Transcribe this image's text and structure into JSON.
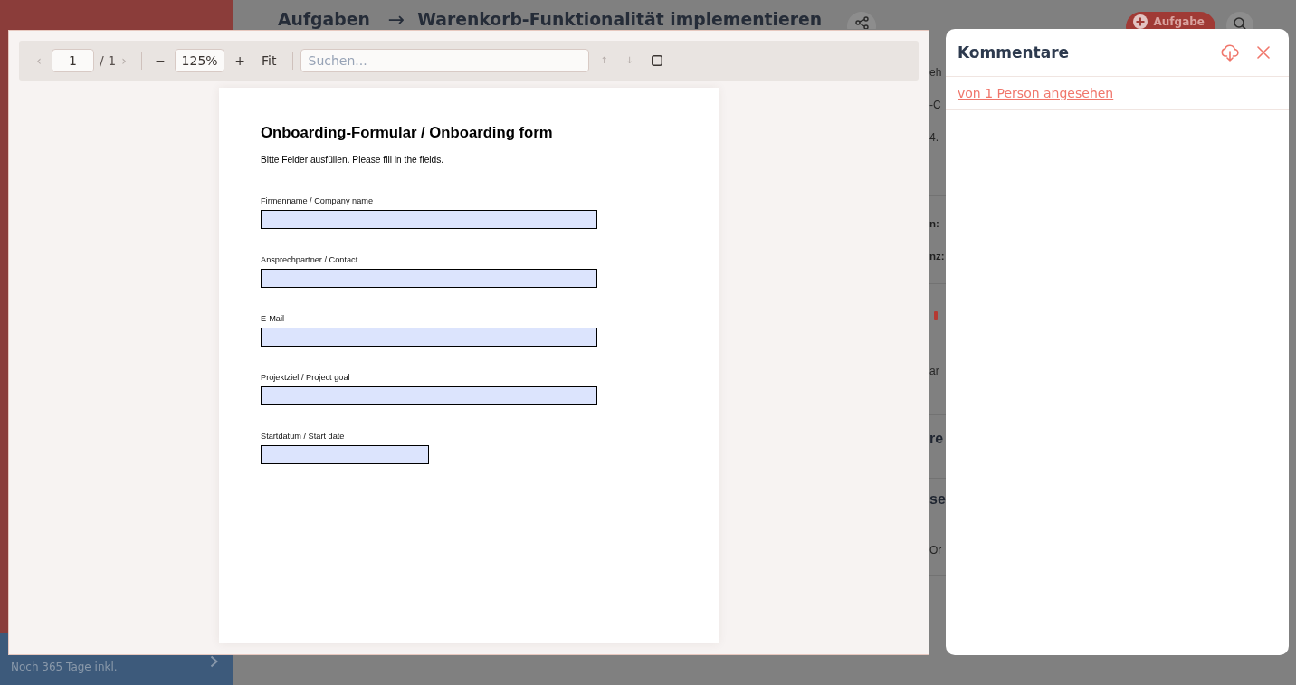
{
  "background": {
    "header": {
      "section": "Aufgaben",
      "separator": "→",
      "task_title": "Warenkorb-Funktionalität implementieren",
      "add_button": "Aufgabe"
    },
    "detail_sections": [
      {
        "items": [
          {
            "kind": "text",
            "text": "eh"
          },
          {
            "kind": "text",
            "text": "-C"
          },
          {
            "kind": "text",
            "text": "4."
          }
        ]
      },
      {
        "items": [
          {
            "kind": "label",
            "text": "n:"
          },
          {
            "kind": "label",
            "text": "nz:"
          }
        ]
      },
      {
        "items": [
          {
            "kind": "icon"
          },
          {
            "kind": "text",
            "text": "ar"
          }
        ]
      },
      {
        "items": [
          {
            "kind": "heading",
            "text": "re"
          }
        ]
      },
      {
        "items": [
          {
            "kind": "heading",
            "text": "se"
          },
          {
            "kind": "text",
            "text": "Or"
          }
        ]
      }
    ],
    "upgrade_banner": {
      "subtitle": "Noch 365 Tage inkl."
    }
  },
  "viewer": {
    "toolbar": {
      "prev_page": {
        "label": "‹",
        "disabled": true
      },
      "page": "1",
      "page_total": "/ 1",
      "next_page": {
        "label": "›",
        "disabled": true
      },
      "zoom_out": {
        "label": "−",
        "disabled": false
      },
      "zoom": "125%",
      "zoom_in": {
        "label": "+",
        "disabled": false
      },
      "fit": {
        "label": "Fit",
        "disabled": false
      },
      "search": {
        "placeholder": "Suchen..."
      },
      "find_previous": {
        "label": "↑",
        "disabled": true
      },
      "find_next": {
        "label": "↓",
        "disabled": true
      }
    },
    "document": {
      "title": "Onboarding-Formular / Onboarding form",
      "intro": "Bitte Felder ausfüllen. Please fill in the fields.",
      "fields": [
        {
          "kind": "text",
          "label": "Firmenname / Company name"
        },
        {
          "kind": "text",
          "label": "Ansprechpartner / Contact"
        },
        {
          "kind": "text",
          "label": "E-Mail"
        },
        {
          "kind": "text",
          "label": "Projektziel / Project goal"
        },
        {
          "kind": "date",
          "label": "Startdatum / Start date"
        }
      ]
    }
  },
  "comments_panel": {
    "title": "Kommentare",
    "viewed_by_link": "von 1 Person angesehen"
  }
}
